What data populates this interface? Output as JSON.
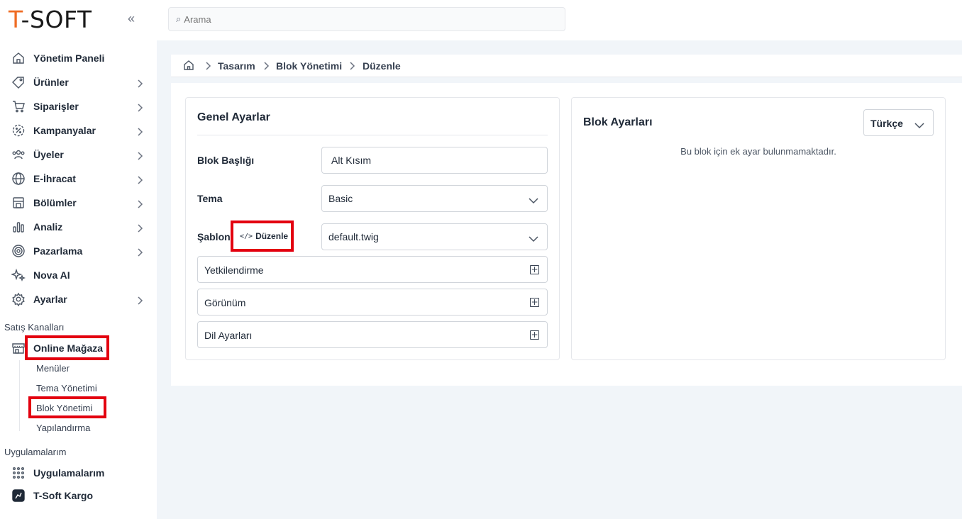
{
  "brand": {
    "logo_accent": "T",
    "logo_rest": "-SOFT",
    "accent_color": "#ef6c24",
    "highlight_color": "#e3000f"
  },
  "search": {
    "placeholder": "Arama"
  },
  "sidebar": {
    "items": [
      {
        "label": "Yönetim Paneli",
        "icon": "home-icon",
        "has_submenu": false
      },
      {
        "label": "Ürünler",
        "icon": "tag-icon",
        "has_submenu": true
      },
      {
        "label": "Siparişler",
        "icon": "cart-icon",
        "has_submenu": true
      },
      {
        "label": "Kampanyalar",
        "icon": "discount-icon",
        "has_submenu": true
      },
      {
        "label": "Üyeler",
        "icon": "users-icon",
        "has_submenu": true
      },
      {
        "label": "E-İhracat",
        "icon": "globe-icon",
        "has_submenu": true
      },
      {
        "label": "Bölümler",
        "icon": "sections-icon",
        "has_submenu": true
      },
      {
        "label": "Analiz",
        "icon": "analytics-icon",
        "has_submenu": true
      },
      {
        "label": "Pazarlama",
        "icon": "target-icon",
        "has_submenu": true
      },
      {
        "label": "Nova AI",
        "icon": "sparkles-icon",
        "has_submenu": false
      },
      {
        "label": "Ayarlar",
        "icon": "gear-icon",
        "has_submenu": true
      }
    ],
    "sales_channels_label": "Satış Kanalları",
    "online_store": {
      "label": "Online Mağaza",
      "icon": "store-icon"
    },
    "online_store_sub": [
      "Menüler",
      "Tema Yönetimi",
      "Blok Yönetimi",
      "Yapılandırma"
    ],
    "apps_label": "Uygulamalarım",
    "apps_items": [
      {
        "label": "Uygulamalarım",
        "icon": "apps-grid-icon"
      },
      {
        "label": "T-Soft Kargo",
        "icon": "kargo-icon"
      }
    ]
  },
  "breadcrumb": [
    "Tasarım",
    "Blok Yönetimi",
    "Düzenle"
  ],
  "general": {
    "title": "Genel Ayarlar",
    "block_title_label": "Blok Başlığı",
    "block_title_value": "Alt Kısım",
    "theme_label": "Tema",
    "theme_value": "Basic",
    "template_label": "Şablon",
    "template_edit_label": "Düzenle",
    "template_value": "default.twig",
    "accordions": [
      "Yetkilendirme",
      "Görünüm",
      "Dil Ayarları"
    ]
  },
  "block_settings": {
    "title": "Blok Ayarları",
    "language": "Türkçe",
    "empty_message": "Bu blok için ek ayar bulunmamaktadır."
  }
}
